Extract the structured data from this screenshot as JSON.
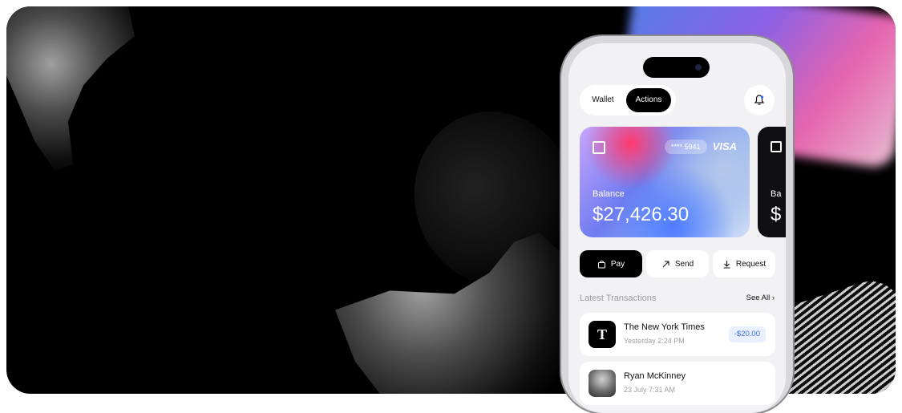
{
  "header": {
    "tabs": [
      "Wallet",
      "Actions"
    ],
    "active_tab": "Actions"
  },
  "card": {
    "masked_number": "**** 5941",
    "brand": "VISA",
    "balance_label": "Balance",
    "balance": "$27,426.30"
  },
  "card2_partial": {
    "label": "Ba",
    "value": "$"
  },
  "actions": [
    "Pay",
    "Send",
    "Request"
  ],
  "transactions_section": {
    "title": "Latest Transactions",
    "see_all": "See All"
  },
  "transactions": [
    {
      "name": "The New York Times",
      "time": "Yesterday 2:24 PM",
      "amount": "-$20.00",
      "logo": "T"
    },
    {
      "name": "Ryan McKinney",
      "time": "23 July 7:31 AM",
      "amount": ""
    }
  ],
  "colors": {
    "accent": "#000000",
    "amount_negative": "#3a6bdc",
    "screen_bg": "#f2f2f4"
  },
  "icons": [
    "bell-icon",
    "bag-icon",
    "arrow-up-right-icon",
    "arrow-down-icon",
    "chevron-right-icon",
    "chase-icon"
  ]
}
